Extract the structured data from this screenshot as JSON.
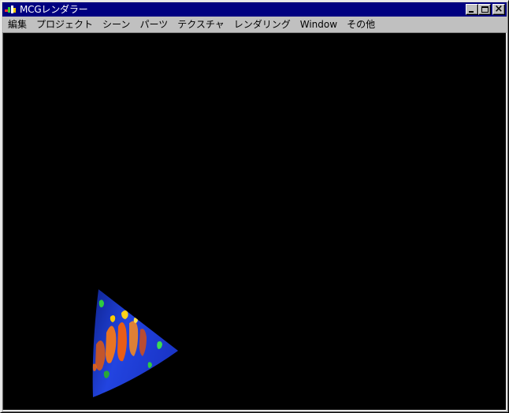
{
  "window": {
    "title": "MCGレンダラー"
  },
  "menu": {
    "items": [
      "編集",
      "プロジェクト",
      "シーン",
      "パーツ",
      "テクスチャ",
      "レンダリング",
      "Window",
      "その他"
    ]
  },
  "caption_buttons": {
    "minimize_icon": "minimize-icon",
    "maximize_icon": "maximize-icon",
    "close_icon": "close-icon"
  },
  "viewport": {
    "background_color": "#000000",
    "object": "textured cone",
    "object_color": "#1f3fd8",
    "texture_colors": [
      "#ff6a00",
      "#ffcc00",
      "#2ecc40"
    ]
  }
}
